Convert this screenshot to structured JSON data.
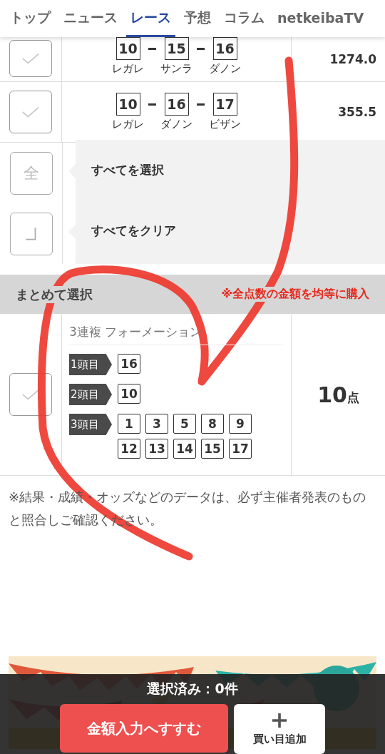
{
  "tabs": [
    {
      "label": "トップ",
      "selected": false
    },
    {
      "label": "ニュース",
      "selected": false
    },
    {
      "label": "レース",
      "selected": true
    },
    {
      "label": "予想",
      "selected": false
    },
    {
      "label": "コラム",
      "selected": false
    },
    {
      "label": "netkeibaTV",
      "selected": false
    }
  ],
  "combos": [
    {
      "checked": false,
      "horses": [
        {
          "number": "10",
          "name": "レガレ"
        },
        {
          "number": "15",
          "name": "サンラ"
        },
        {
          "number": "16",
          "name": "ダノン"
        }
      ],
      "odds": "1274.0"
    },
    {
      "checked": false,
      "horses": [
        {
          "number": "10",
          "name": "レガレ"
        },
        {
          "number": "16",
          "name": "ダノン"
        },
        {
          "number": "17",
          "name": "ビザン"
        }
      ],
      "odds": "355.5"
    }
  ],
  "bulk_actions": [
    {
      "kind": "select_all",
      "icon": "全",
      "label": "すべてを選択"
    },
    {
      "kind": "clear",
      "label": "すべてをクリア"
    }
  ],
  "section": {
    "title": "まとめて選択",
    "note": "※全点数の金額を均等に購入"
  },
  "formation": {
    "checked": false,
    "title": "3連複 フォーメーション",
    "legs": [
      {
        "label": "1頭目",
        "numbers": [
          "16"
        ]
      },
      {
        "label": "2頭目",
        "numbers": [
          "10"
        ]
      },
      {
        "label": "3頭目",
        "numbers": [
          "1",
          "3",
          "5",
          "8",
          "9",
          "12",
          "13",
          "14",
          "15",
          "17"
        ]
      }
    ],
    "count": "10",
    "unit": "点"
  },
  "disclaimer": "※結果・成績・オッズなどのデータは、必ず主催者発表のものと照合しご確認ください。",
  "footer": {
    "selected_label": "選択済み：0件",
    "proceed": "金額入力へすすむ",
    "add": "買い目追加"
  }
}
